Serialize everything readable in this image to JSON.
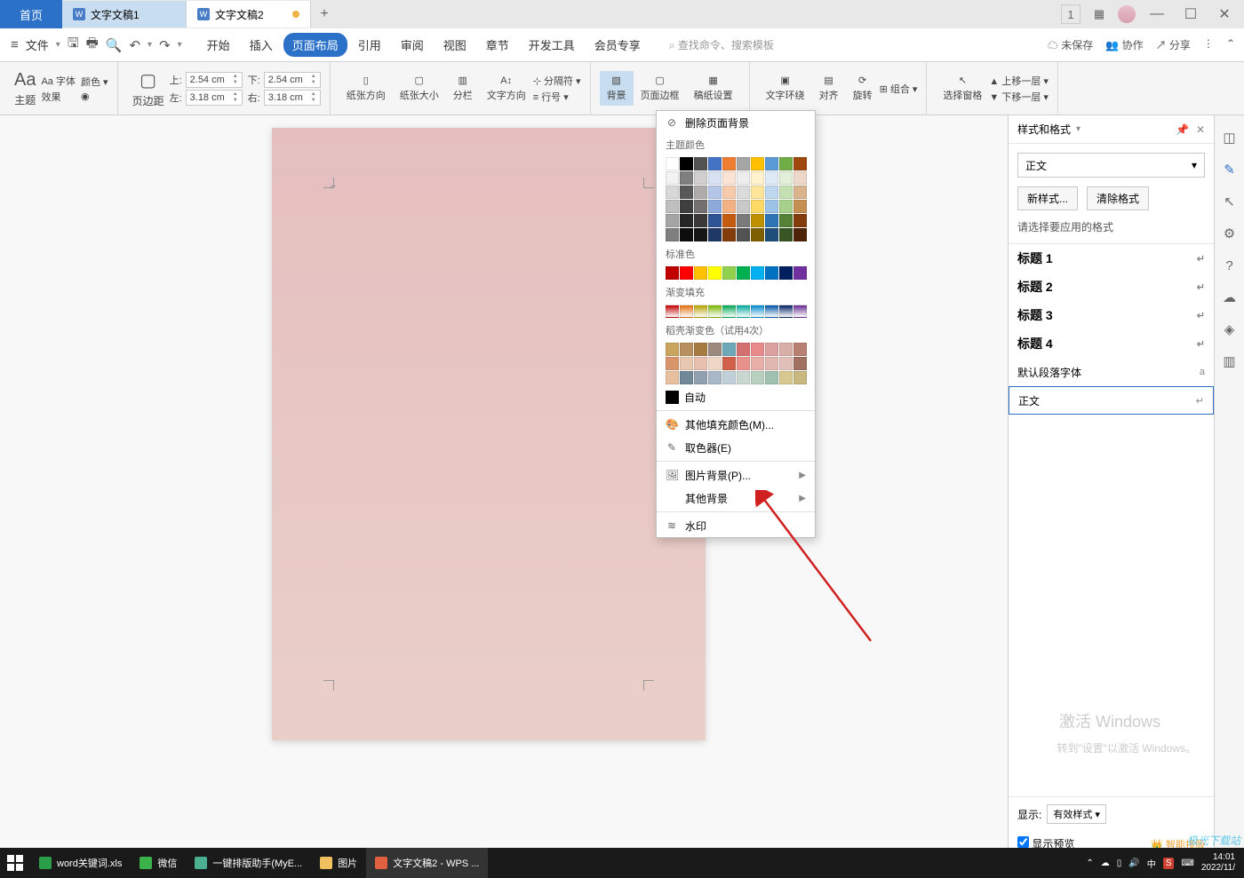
{
  "titlebar": {
    "home": "首页",
    "tabs": [
      {
        "label": "文字文稿1",
        "active": false,
        "modified": false
      },
      {
        "label": "文字文稿2",
        "active": true,
        "modified": true
      }
    ]
  },
  "menubar": {
    "file": "文件",
    "items": [
      "开始",
      "插入",
      "页面布局",
      "引用",
      "审阅",
      "视图",
      "章节",
      "开发工具",
      "会员专享"
    ],
    "active": "页面布局",
    "search": "查找命令、搜索模板",
    "right": {
      "unsaved": "未保存",
      "collab": "协作",
      "share": "分享"
    }
  },
  "ribbon": {
    "theme": "主题",
    "font": "Aa 字体",
    "color": "颜色",
    "effect": "效果",
    "margin": "页边距",
    "top_label": "上:",
    "top_val": "2.54 cm",
    "bottom_label": "下:",
    "bottom_val": "2.54 cm",
    "left_label": "左:",
    "left_val": "3.18 cm",
    "right_label": "右:",
    "right_val": "3.18 cm",
    "orientation": "纸张方向",
    "size": "纸张大小",
    "columns": "分栏",
    "textdir": "文字方向",
    "separator": "分隔符",
    "lineno": "行号",
    "bg": "背景",
    "border": "页面边框",
    "note": "稿纸设置",
    "wrap": "文字环绕",
    "align": "对齐",
    "rotate": "旋转",
    "selpane": "选择窗格",
    "group": "组合",
    "up": "上移一层",
    "down": "下移一层"
  },
  "popup": {
    "del_bg": "删除页面背景",
    "theme_colors": "主题颜色",
    "standard": "标准色",
    "gradient": "渐变填充",
    "shell_grad": "稻壳渐变色（试用4次）",
    "auto": "自动",
    "other_fill": "其他填充颜色(M)...",
    "picker": "取色器(E)",
    "pic_bg": "图片背景(P)...",
    "other_bg": "其他背景",
    "watermark": "水印",
    "theme_palette": [
      [
        "#ffffff",
        "#000000",
        "#535353",
        "#4472c4",
        "#ed7d31",
        "#a5a5a5",
        "#ffc000",
        "#5b9bd5",
        "#70ad47",
        "#9e480e"
      ],
      [
        "#f2f2f2",
        "#7f7f7f",
        "#d0cece",
        "#d9e2f3",
        "#fbe4d5",
        "#ededed",
        "#fff2cc",
        "#deeaf6",
        "#e2efd9",
        "#ecd7c8"
      ],
      [
        "#d8d8d8",
        "#595959",
        "#aeabab",
        "#b4c6e7",
        "#f7caac",
        "#dbdbdb",
        "#fee599",
        "#bdd7ee",
        "#c5e0b3",
        "#d9b38c"
      ],
      [
        "#bfbfbf",
        "#3f3f3f",
        "#757070",
        "#8eaadb",
        "#f4b183",
        "#c9c9c9",
        "#ffd965",
        "#9cc3e5",
        "#a8d08d",
        "#c68f51"
      ],
      [
        "#a5a5a5",
        "#262626",
        "#3a3838",
        "#2f5496",
        "#c55a11",
        "#7b7b7b",
        "#bf9000",
        "#2e75b5",
        "#538135",
        "#833c0b"
      ],
      [
        "#7f7f7f",
        "#0c0c0c",
        "#171616",
        "#1f3864",
        "#833c0b",
        "#525252",
        "#7f6000",
        "#1e4e79",
        "#375623",
        "#4d2308"
      ]
    ],
    "standard_palette": [
      "#c00000",
      "#ff0000",
      "#ffc000",
      "#ffff00",
      "#92d050",
      "#00b050",
      "#00b0f0",
      "#0070c0",
      "#002060",
      "#7030a0"
    ],
    "gradient_palette": [
      "#c00000",
      "#e36c0a",
      "#b3a200",
      "#79b400",
      "#00a650",
      "#00a99d",
      "#0088cc",
      "#0054a6",
      "#002060",
      "#662d91"
    ],
    "shell_palette": [
      [
        "#c9a55f",
        "#b89060",
        "#a67b42",
        "#9c8a7e",
        "#6fa8b8",
        "#d47070",
        "#e88a8a",
        "#dba0a0",
        "#d8b0a8",
        "#b88070"
      ],
      [
        "#d8956a",
        "#e8c8b0",
        "#e8c0b0",
        "#f0d8c8",
        "#d0604a",
        "#e8908a",
        "#e8b0a8",
        "#e0b8b0",
        "#e0c0b8",
        "#a07060"
      ],
      [
        "#e8c0a0",
        "#708898",
        "#90a0b0",
        "#a8b8c8",
        "#c0d0d8",
        "#c8d8d0",
        "#b8d0c0",
        "#a0c0b0",
        "#d8c890",
        "#c8b880"
      ]
    ]
  },
  "rightpanel": {
    "title": "样式和格式",
    "current": "正文",
    "new_style": "新样式...",
    "clear": "清除格式",
    "label": "请选择要应用的格式",
    "styles": [
      {
        "name": "标题 1",
        "h": true
      },
      {
        "name": "标题 2",
        "h": true
      },
      {
        "name": "标题 3",
        "h": true
      },
      {
        "name": "标题 4",
        "h": true
      },
      {
        "name": "默认段落字体",
        "h": false,
        "mark": "a"
      },
      {
        "name": "正文",
        "h": false,
        "selected": true
      }
    ],
    "show_label": "显示:",
    "show_val": "有效样式",
    "preview": "显示预览",
    "smart": "智能排版"
  },
  "watermarks": {
    "activate": "激活 Windows",
    "activate_sub": "转到\"设置\"以激活 Windows。",
    "brand": "极光下载站"
  },
  "taskbar": {
    "items": [
      {
        "label": "word关键词.xls",
        "color": "#2b9e4a"
      },
      {
        "label": "微信",
        "color": "#3cb34a"
      },
      {
        "label": "一键排版助手(MyE...",
        "color": "#4ab090"
      },
      {
        "label": "图片",
        "color": "#f0c060"
      },
      {
        "label": "文字文稿2 - WPS ...",
        "color": "#e06040",
        "active": true
      }
    ],
    "time": "14:01",
    "date": "2022/11/"
  }
}
